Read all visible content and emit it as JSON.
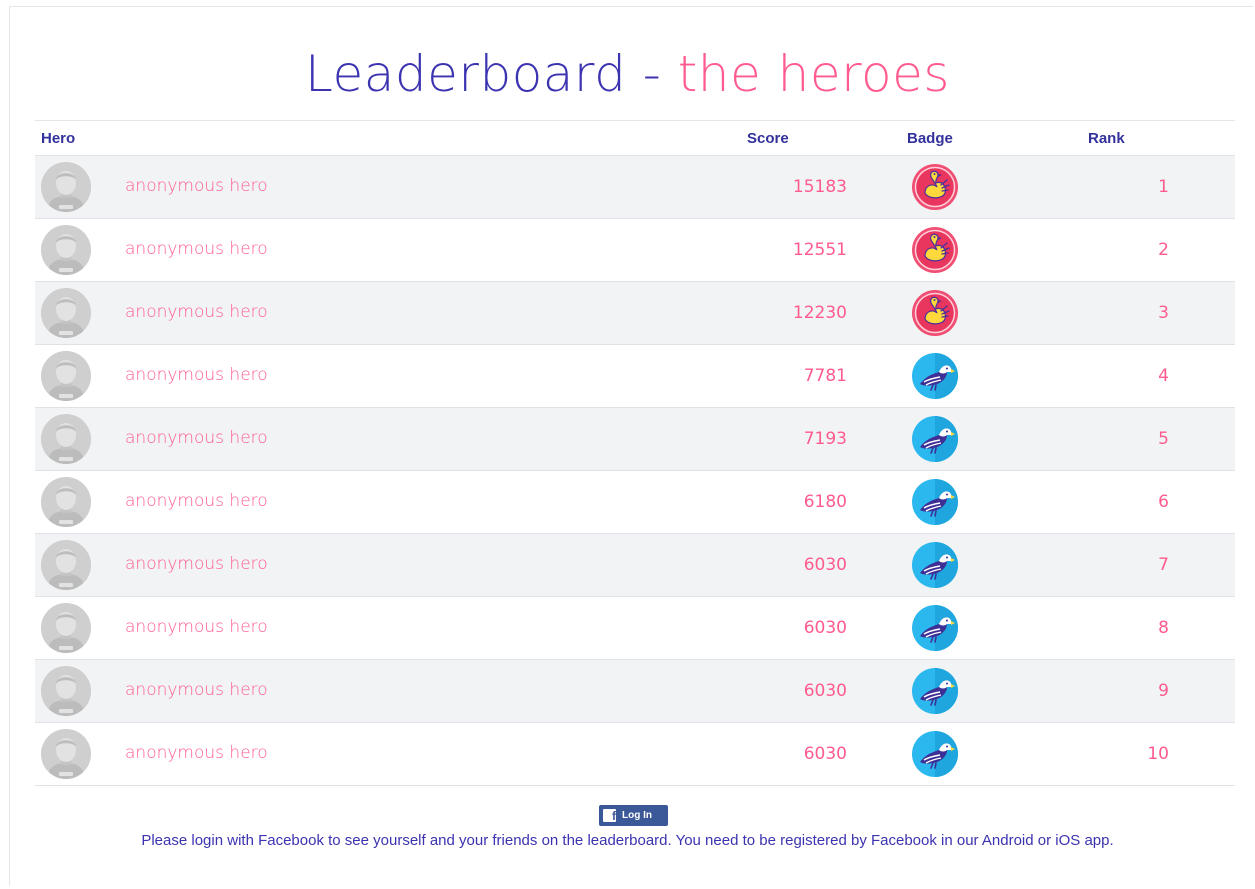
{
  "header": {
    "title_part1": "Leaderboard - ",
    "title_part2": "the heroes"
  },
  "table": {
    "columns": {
      "hero": "Hero",
      "score": "Score",
      "badge": "Badge",
      "rank": "Rank"
    },
    "rows": [
      {
        "name": "anonymous hero",
        "score": "15183",
        "badge": "swan-badge-icon",
        "rank": "1"
      },
      {
        "name": "anonymous hero",
        "score": "12551",
        "badge": "swan-badge-icon",
        "rank": "2"
      },
      {
        "name": "anonymous hero",
        "score": "12230",
        "badge": "swan-badge-icon",
        "rank": "3"
      },
      {
        "name": "anonymous hero",
        "score": "7781",
        "badge": "eagle-badge-icon",
        "rank": "4"
      },
      {
        "name": "anonymous hero",
        "score": "7193",
        "badge": "eagle-badge-icon",
        "rank": "5"
      },
      {
        "name": "anonymous hero",
        "score": "6180",
        "badge": "eagle-badge-icon",
        "rank": "6"
      },
      {
        "name": "anonymous hero",
        "score": "6030",
        "badge": "eagle-badge-icon",
        "rank": "7"
      },
      {
        "name": "anonymous hero",
        "score": "6030",
        "badge": "eagle-badge-icon",
        "rank": "8"
      },
      {
        "name": "anonymous hero",
        "score": "6030",
        "badge": "eagle-badge-icon",
        "rank": "9"
      },
      {
        "name": "anonymous hero",
        "score": "6030",
        "badge": "eagle-badge-icon",
        "rank": "10"
      }
    ]
  },
  "footer": {
    "login_label": "Log In",
    "fb_icon": "facebook-icon",
    "note": "Please login with Facebook to see yourself and your friends on the leaderboard. You need to be registered by Facebook in our Android or iOS app."
  },
  "colors": {
    "title_blue": "#3b33b0",
    "accent_pink": "#ff5b8e",
    "facebook_blue": "#3b5998"
  }
}
